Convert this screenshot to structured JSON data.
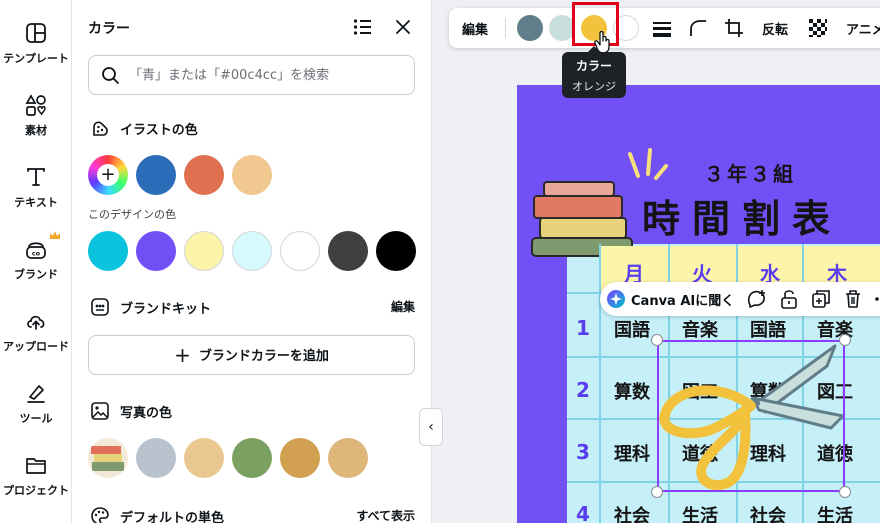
{
  "rail": {
    "items": [
      {
        "label": "テンプレート"
      },
      {
        "label": "素材"
      },
      {
        "label": "テキスト"
      },
      {
        "label": "ブランド"
      },
      {
        "label": "アップロード"
      },
      {
        "label": "ツール"
      },
      {
        "label": "プロジェクト"
      }
    ]
  },
  "panel": {
    "title": "カラー",
    "search_placeholder": "「青」または「#00c4cc」を検索",
    "illust": {
      "title": "イラストの色",
      "colors": [
        "#2b6cb8",
        "#e07050",
        "#f0c890"
      ]
    },
    "design": {
      "title": "このデザインの色",
      "colors": [
        "#0bc3dc",
        "#7150f5",
        "#fcf4a8",
        "#d6f9fd",
        "#ffffff",
        "#3f3f3f",
        "#000000"
      ]
    },
    "brand": {
      "title": "ブランドキット",
      "action": "編集",
      "add_label": "ブランドカラーを追加"
    },
    "photo": {
      "title": "写真の色",
      "colors": [
        "#b8c3cd",
        "#e9c890",
        "#7aa160",
        "#d1a050",
        "#ddb77a"
      ]
    },
    "default": {
      "title": "デフォルトの単色",
      "action": "すべて表示"
    }
  },
  "toolbar": {
    "edit_label": "編集",
    "colors": [
      "#617d8a",
      "#c8dfdc",
      "#f2c23c",
      "#ffffff"
    ],
    "flip_label": "反転",
    "anim_label": "アニメ"
  },
  "tooltip": {
    "title": "カラー",
    "subtitle": "オレンジ"
  },
  "canvas": {
    "subtitle": "３年３組",
    "title": "時間割表",
    "days": [
      "月",
      "火",
      "水",
      "木"
    ],
    "periods": [
      "1",
      "2",
      "3",
      "4"
    ],
    "rows": [
      [
        "国語",
        "音楽",
        "国語",
        "音楽"
      ],
      [
        "算数",
        "図工",
        "算数",
        "図工"
      ],
      [
        "理科",
        "道徳",
        "理科",
        "道徳"
      ],
      [
        "社会",
        "生活",
        "社会",
        "生活"
      ]
    ],
    "ai_label": "Canva AIに聞く"
  }
}
